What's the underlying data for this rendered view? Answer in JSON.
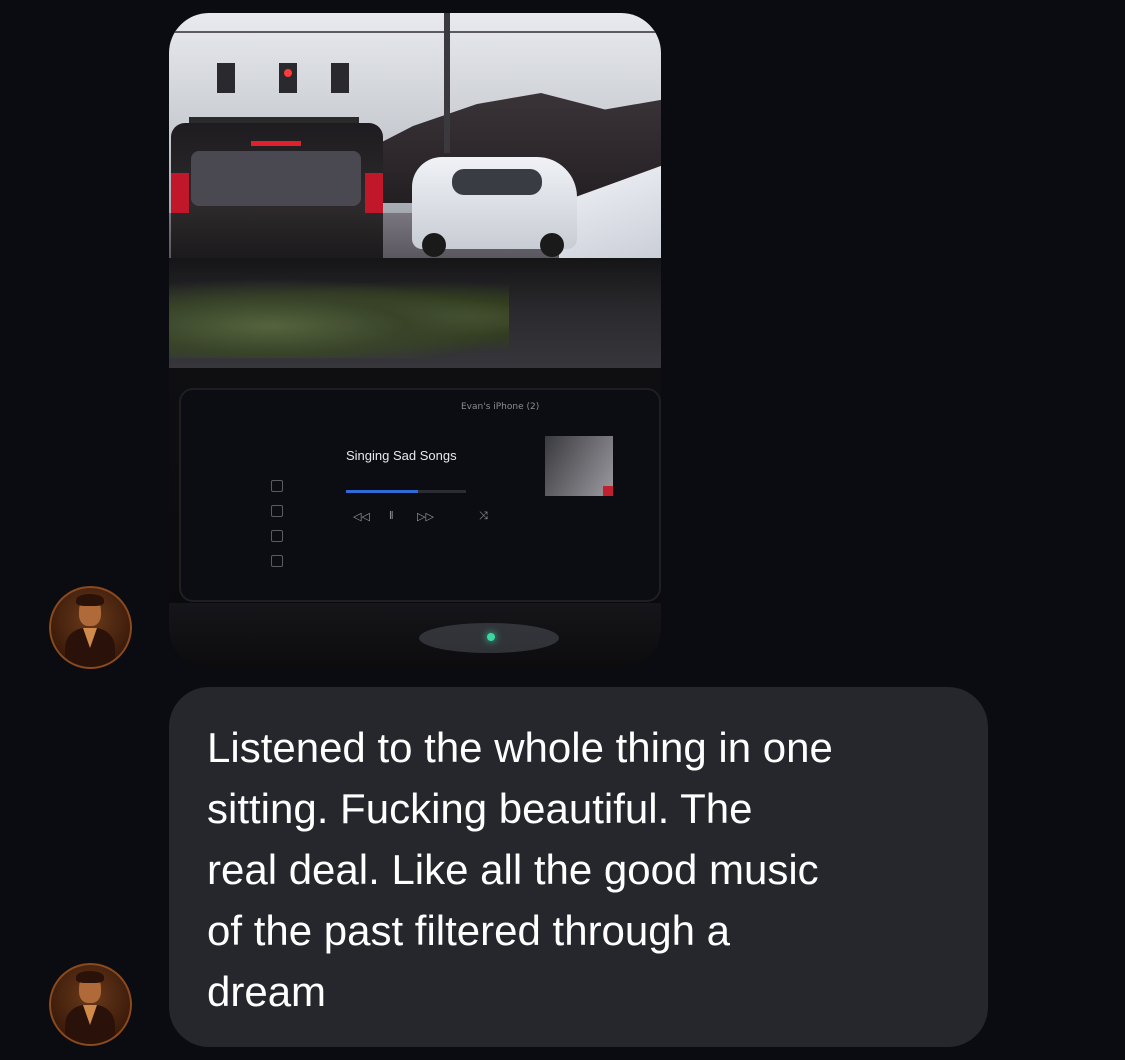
{
  "thread": {
    "photo_message": {
      "screen": {
        "device": "Evan's iPhone (2)",
        "song_title": "Singing Sad Songs",
        "progress": 0.6
      }
    },
    "text_message": {
      "body": "Listened to the whole thing in one\nsitting.  Fucking beautiful.  The\nreal deal.  Like all the good music\nof the past filtered through a\ndream"
    }
  },
  "colors": {
    "background": "#0b0c11",
    "bubble": "#26272c",
    "text": "#ffffff"
  }
}
